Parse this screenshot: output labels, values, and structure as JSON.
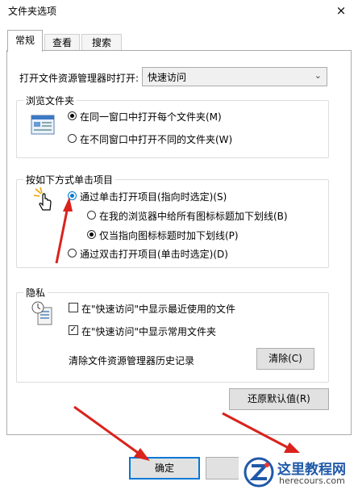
{
  "window": {
    "title": "文件夹选项",
    "close_icon": "×"
  },
  "tabs": [
    "常规",
    "查看",
    "搜索"
  ],
  "open_in": {
    "label": "打开文件资源管理器时打开:",
    "value": "快速访问"
  },
  "browse": {
    "legend": "浏览文件夹",
    "options": [
      "在同一窗口中打开每个文件夹(M)",
      "在不同窗口中打开不同的文件夹(W)"
    ],
    "selected": 0
  },
  "click": {
    "legend": "按如下方式单击项目",
    "single": "通过单击打开项目(指向时选定)(S)",
    "underline_all": "在我的浏览器中给所有图标标题加下划线(B)",
    "underline_point": "仅当指向图标标题时加下划线(P)",
    "double": "通过双击打开项目(单击时选定)(D)"
  },
  "privacy": {
    "legend": "隐私",
    "recent_files": "在\"快速访问\"中显示最近使用的文件",
    "recent_files_checked": false,
    "frequent_folders": "在\"快速访问\"中显示常用文件夹",
    "frequent_folders_checked": true,
    "clear_history_label": "清除文件资源管理器历史记录",
    "clear_button": "清除(C)"
  },
  "restore_defaults": "还原默认值(R)",
  "ok_button": "确定",
  "watermark": {
    "text": "这里教程网",
    "url": "herecours.com"
  },
  "colors": {
    "accent": "#0078d7",
    "arrow": "#d9231c"
  }
}
